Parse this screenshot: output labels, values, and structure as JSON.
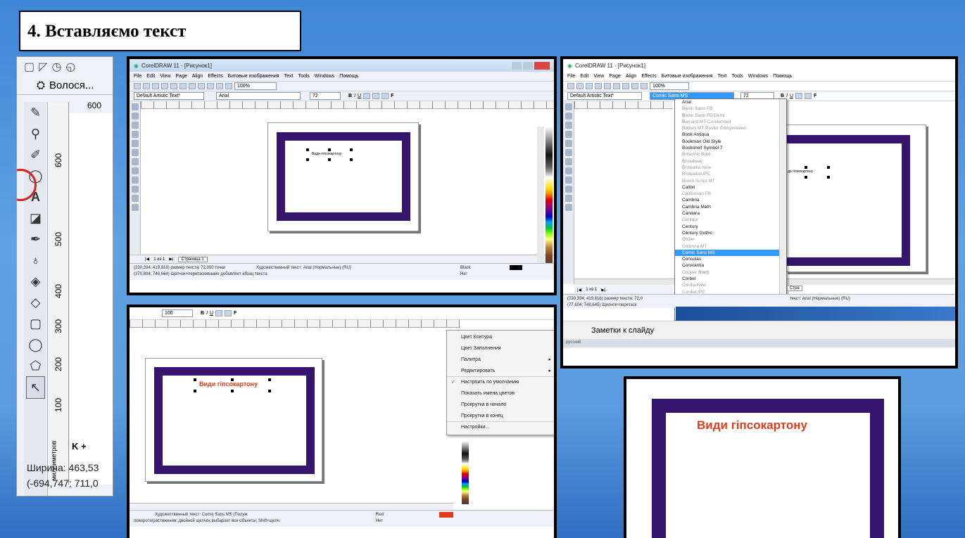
{
  "slide": {
    "title": "4. Вставляємо текст"
  },
  "left_panel": {
    "field_text": "Волося...",
    "ruler_top": "600",
    "vruler_labels": [
      "600",
      "500",
      "400",
      "300",
      "200",
      "100"
    ],
    "vruler_unit": "миллиметров",
    "nav": "K  +",
    "width_label": "Ширина: 463,53",
    "coords": "(-694,747; 711,0"
  },
  "shot_a": {
    "window_title": "CorelDRAW 11 - [Рисунок1]",
    "menu": [
      "File",
      "Edit",
      "View",
      "Page",
      "Align",
      "Effects",
      "Битовые изображения",
      "Text",
      "Tools",
      "Windows",
      "Помощь"
    ],
    "zoom": "100%",
    "style_combo": "Default Artistic Text*",
    "font_combo": "Arial",
    "size_combo": "72",
    "canvas_text": "Види гіпсокартону",
    "page_tab": "Страница 1",
    "page_nav": "1 из 1",
    "status_line1": "(230,334; 419,816)  размер текста: 72,000 точки",
    "status_obj": "Художественный текст: Arial (Нормальные) (RU)",
    "status_line2": "(270,894; 748,664)  Щелчок+перетаскивание добавляет абзац текста",
    "fill_label": "Black",
    "outline_label": "Нет"
  },
  "shot_b": {
    "window_title": "CorelDRAW 11 - [Рисунок1]",
    "menu": [
      "File",
      "Edit",
      "View",
      "Page",
      "Align",
      "Effects",
      "Битовые изображения",
      "Text",
      "Tools",
      "Windows",
      "Помощь"
    ],
    "zoom": "100%",
    "style_combo": "Default Artistic Text*",
    "font_combo": "Comic Sans MS",
    "size_combo": "72",
    "fonts": [
      {
        "name": "Arial",
        "dim": false
      },
      {
        "name": "Berlin Sans FB",
        "dim": true
      },
      {
        "name": "Berlin Sans FB Demi",
        "dim": true
      },
      {
        "name": "Bernard MT Condensed",
        "dim": true
      },
      {
        "name": "Bodoni MT Poster Compressed",
        "dim": true
      },
      {
        "name": "Book Antiqua",
        "dim": false
      },
      {
        "name": "Bookman Old Style",
        "dim": false
      },
      {
        "name": "Bookshelf Symbol 7",
        "dim": false
      },
      {
        "name": "Britannic Bold",
        "dim": true
      },
      {
        "name": "Broadway",
        "dim": true
      },
      {
        "name": "Browallia New",
        "dim": true
      },
      {
        "name": "BrowalliaUPC",
        "dim": true
      },
      {
        "name": "Brush Script MT",
        "dim": true
      },
      {
        "name": "Calibri",
        "dim": false
      },
      {
        "name": "Californian FB",
        "dim": true
      },
      {
        "name": "Cambria",
        "dim": false
      },
      {
        "name": "Cambria Math",
        "dim": false
      },
      {
        "name": "Candara",
        "dim": false
      },
      {
        "name": "Centaur",
        "dim": true
      },
      {
        "name": "Century",
        "dim": false
      },
      {
        "name": "Century Gothic",
        "dim": false
      },
      {
        "name": "Chiller",
        "dim": true
      },
      {
        "name": "Colonna MT",
        "dim": true
      },
      {
        "name": "Comic Sans MS",
        "dim": false,
        "selected": true
      },
      {
        "name": "Consolas",
        "dim": false
      },
      {
        "name": "Constantia",
        "dim": false
      },
      {
        "name": "Cooper Black",
        "dim": true
      },
      {
        "name": "Corbel",
        "dim": false
      },
      {
        "name": "Cordia New",
        "dim": true
      },
      {
        "name": "CordiaUPC",
        "dim": true
      },
      {
        "name": "Courier New",
        "dim": false
      },
      {
        "name": "CurlzMT",
        "dim": true
      },
      {
        "name": "David",
        "dim": true
      }
    ],
    "canvas_text": "да гіпсокартону",
    "page_tab": "Стра",
    "page_nav": "1 из 1",
    "status_line1": "(230,334; 419,816)  размер текста: 72,0",
    "status_obj": "текст: Arial (Нормальные) (RU)",
    "status_line2": "(77,604; 748,645)  Щелчок+перетаск",
    "notes_label": "Заметки к слайду",
    "lang": "русский"
  },
  "shot_c": {
    "size_combo": "100",
    "canvas_text": "Види гіпсокартону",
    "context_menu": [
      {
        "label": "Цвет Контура",
        "arrow": false,
        "check": false
      },
      {
        "label": "Цвет Заполнения",
        "arrow": false,
        "check": false
      },
      {
        "label": "Палитра",
        "arrow": true,
        "check": false
      },
      {
        "label": "Редактировать",
        "arrow": true,
        "check": false
      },
      {
        "label": "Настроить по умолчанию",
        "arrow": false,
        "check": true
      },
      {
        "label": "Показать имена цветов",
        "arrow": false,
        "check": false
      },
      {
        "label": "Прокрутка в начало",
        "arrow": false,
        "check": false
      },
      {
        "label": "Прокрутка в конец",
        "arrow": false,
        "check": false
      },
      {
        "label": "Настройки...",
        "arrow": false,
        "check": false
      }
    ],
    "status_obj": "Художественный текст: Comic Sans MS (Полуж",
    "status_line2": "поворота/растяжения; двойной щелчок выбирает все объекты; Shift+щелч",
    "fill_label": "Red",
    "outline_label": "Нет"
  },
  "shot_d": {
    "canvas_text": "Види гіпсокартону"
  },
  "colors": {
    "accent_purple": "#35146e",
    "text_red": "#e03c1a",
    "highlight": "#3399ff"
  }
}
